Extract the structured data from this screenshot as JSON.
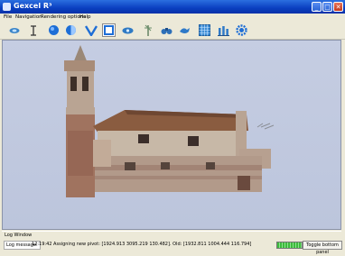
{
  "window": {
    "title": "Gexcel R³",
    "minimize_icon": "minimize-icon",
    "maximize_icon": "maximize-icon",
    "close_icon": "close-icon"
  },
  "menu": [
    "File",
    "Navigation",
    "Rendering options",
    "Help"
  ],
  "toolbar": {
    "icons": [
      "navigate-icon",
      "pick-point-icon",
      "sphere-icon",
      "half-sphere-icon",
      "v-shape-icon",
      "box-icon",
      "eye-icon",
      "magic-wand-icon",
      "binoculars-icon",
      "bird-icon",
      "grid-icon",
      "bars-icon",
      "gear-icon"
    ],
    "active": "box-icon"
  },
  "log": {
    "title": "Log Window"
  },
  "status": {
    "label": "Log message:",
    "message": "12:19:42  Assigning new pivot: [1924.913 3095.219 130.482]. Old: [1932.811 1004.444 116.794]",
    "progress": 1.0,
    "toggle_label": "Toggle bottom panel"
  },
  "colors": {
    "titlebar": "#0a3fc0",
    "viewport_bg": "#c5cde2",
    "accent": "#1f5fd6"
  }
}
